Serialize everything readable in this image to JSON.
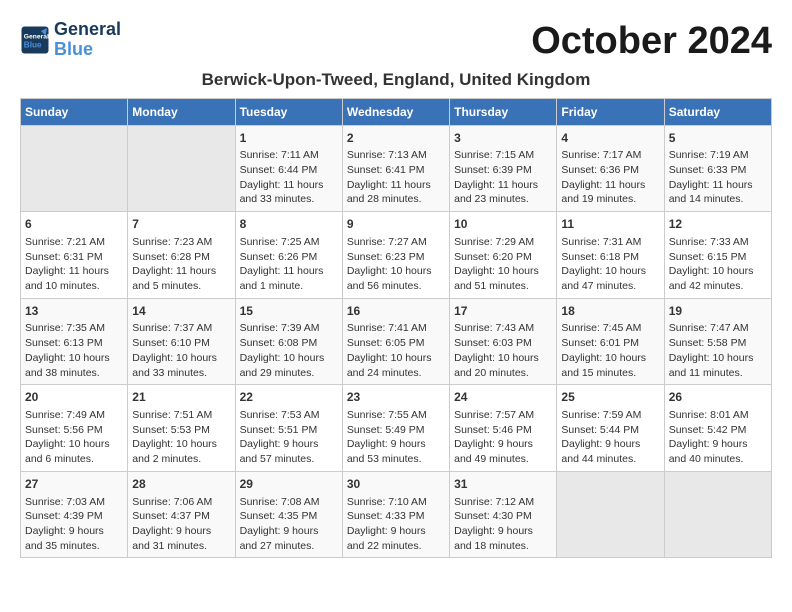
{
  "header": {
    "logo_line1": "General",
    "logo_line2": "Blue",
    "month_title": "October 2024",
    "location": "Berwick-Upon-Tweed, England, United Kingdom"
  },
  "weekdays": [
    "Sunday",
    "Monday",
    "Tuesday",
    "Wednesday",
    "Thursday",
    "Friday",
    "Saturday"
  ],
  "weeks": [
    [
      {
        "day": "",
        "info": ""
      },
      {
        "day": "",
        "info": ""
      },
      {
        "day": "1",
        "info": "Sunrise: 7:11 AM\nSunset: 6:44 PM\nDaylight: 11 hours\nand 33 minutes."
      },
      {
        "day": "2",
        "info": "Sunrise: 7:13 AM\nSunset: 6:41 PM\nDaylight: 11 hours\nand 28 minutes."
      },
      {
        "day": "3",
        "info": "Sunrise: 7:15 AM\nSunset: 6:39 PM\nDaylight: 11 hours\nand 23 minutes."
      },
      {
        "day": "4",
        "info": "Sunrise: 7:17 AM\nSunset: 6:36 PM\nDaylight: 11 hours\nand 19 minutes."
      },
      {
        "day": "5",
        "info": "Sunrise: 7:19 AM\nSunset: 6:33 PM\nDaylight: 11 hours\nand 14 minutes."
      }
    ],
    [
      {
        "day": "6",
        "info": "Sunrise: 7:21 AM\nSunset: 6:31 PM\nDaylight: 11 hours\nand 10 minutes."
      },
      {
        "day": "7",
        "info": "Sunrise: 7:23 AM\nSunset: 6:28 PM\nDaylight: 11 hours\nand 5 minutes."
      },
      {
        "day": "8",
        "info": "Sunrise: 7:25 AM\nSunset: 6:26 PM\nDaylight: 11 hours\nand 1 minute."
      },
      {
        "day": "9",
        "info": "Sunrise: 7:27 AM\nSunset: 6:23 PM\nDaylight: 10 hours\nand 56 minutes."
      },
      {
        "day": "10",
        "info": "Sunrise: 7:29 AM\nSunset: 6:20 PM\nDaylight: 10 hours\nand 51 minutes."
      },
      {
        "day": "11",
        "info": "Sunrise: 7:31 AM\nSunset: 6:18 PM\nDaylight: 10 hours\nand 47 minutes."
      },
      {
        "day": "12",
        "info": "Sunrise: 7:33 AM\nSunset: 6:15 PM\nDaylight: 10 hours\nand 42 minutes."
      }
    ],
    [
      {
        "day": "13",
        "info": "Sunrise: 7:35 AM\nSunset: 6:13 PM\nDaylight: 10 hours\nand 38 minutes."
      },
      {
        "day": "14",
        "info": "Sunrise: 7:37 AM\nSunset: 6:10 PM\nDaylight: 10 hours\nand 33 minutes."
      },
      {
        "day": "15",
        "info": "Sunrise: 7:39 AM\nSunset: 6:08 PM\nDaylight: 10 hours\nand 29 minutes."
      },
      {
        "day": "16",
        "info": "Sunrise: 7:41 AM\nSunset: 6:05 PM\nDaylight: 10 hours\nand 24 minutes."
      },
      {
        "day": "17",
        "info": "Sunrise: 7:43 AM\nSunset: 6:03 PM\nDaylight: 10 hours\nand 20 minutes."
      },
      {
        "day": "18",
        "info": "Sunrise: 7:45 AM\nSunset: 6:01 PM\nDaylight: 10 hours\nand 15 minutes."
      },
      {
        "day": "19",
        "info": "Sunrise: 7:47 AM\nSunset: 5:58 PM\nDaylight: 10 hours\nand 11 minutes."
      }
    ],
    [
      {
        "day": "20",
        "info": "Sunrise: 7:49 AM\nSunset: 5:56 PM\nDaylight: 10 hours\nand 6 minutes."
      },
      {
        "day": "21",
        "info": "Sunrise: 7:51 AM\nSunset: 5:53 PM\nDaylight: 10 hours\nand 2 minutes."
      },
      {
        "day": "22",
        "info": "Sunrise: 7:53 AM\nSunset: 5:51 PM\nDaylight: 9 hours\nand 57 minutes."
      },
      {
        "day": "23",
        "info": "Sunrise: 7:55 AM\nSunset: 5:49 PM\nDaylight: 9 hours\nand 53 minutes."
      },
      {
        "day": "24",
        "info": "Sunrise: 7:57 AM\nSunset: 5:46 PM\nDaylight: 9 hours\nand 49 minutes."
      },
      {
        "day": "25",
        "info": "Sunrise: 7:59 AM\nSunset: 5:44 PM\nDaylight: 9 hours\nand 44 minutes."
      },
      {
        "day": "26",
        "info": "Sunrise: 8:01 AM\nSunset: 5:42 PM\nDaylight: 9 hours\nand 40 minutes."
      }
    ],
    [
      {
        "day": "27",
        "info": "Sunrise: 7:03 AM\nSunset: 4:39 PM\nDaylight: 9 hours\nand 35 minutes."
      },
      {
        "day": "28",
        "info": "Sunrise: 7:06 AM\nSunset: 4:37 PM\nDaylight: 9 hours\nand 31 minutes."
      },
      {
        "day": "29",
        "info": "Sunrise: 7:08 AM\nSunset: 4:35 PM\nDaylight: 9 hours\nand 27 minutes."
      },
      {
        "day": "30",
        "info": "Sunrise: 7:10 AM\nSunset: 4:33 PM\nDaylight: 9 hours\nand 22 minutes."
      },
      {
        "day": "31",
        "info": "Sunrise: 7:12 AM\nSunset: 4:30 PM\nDaylight: 9 hours\nand 18 minutes."
      },
      {
        "day": "",
        "info": ""
      },
      {
        "day": "",
        "info": ""
      }
    ]
  ]
}
